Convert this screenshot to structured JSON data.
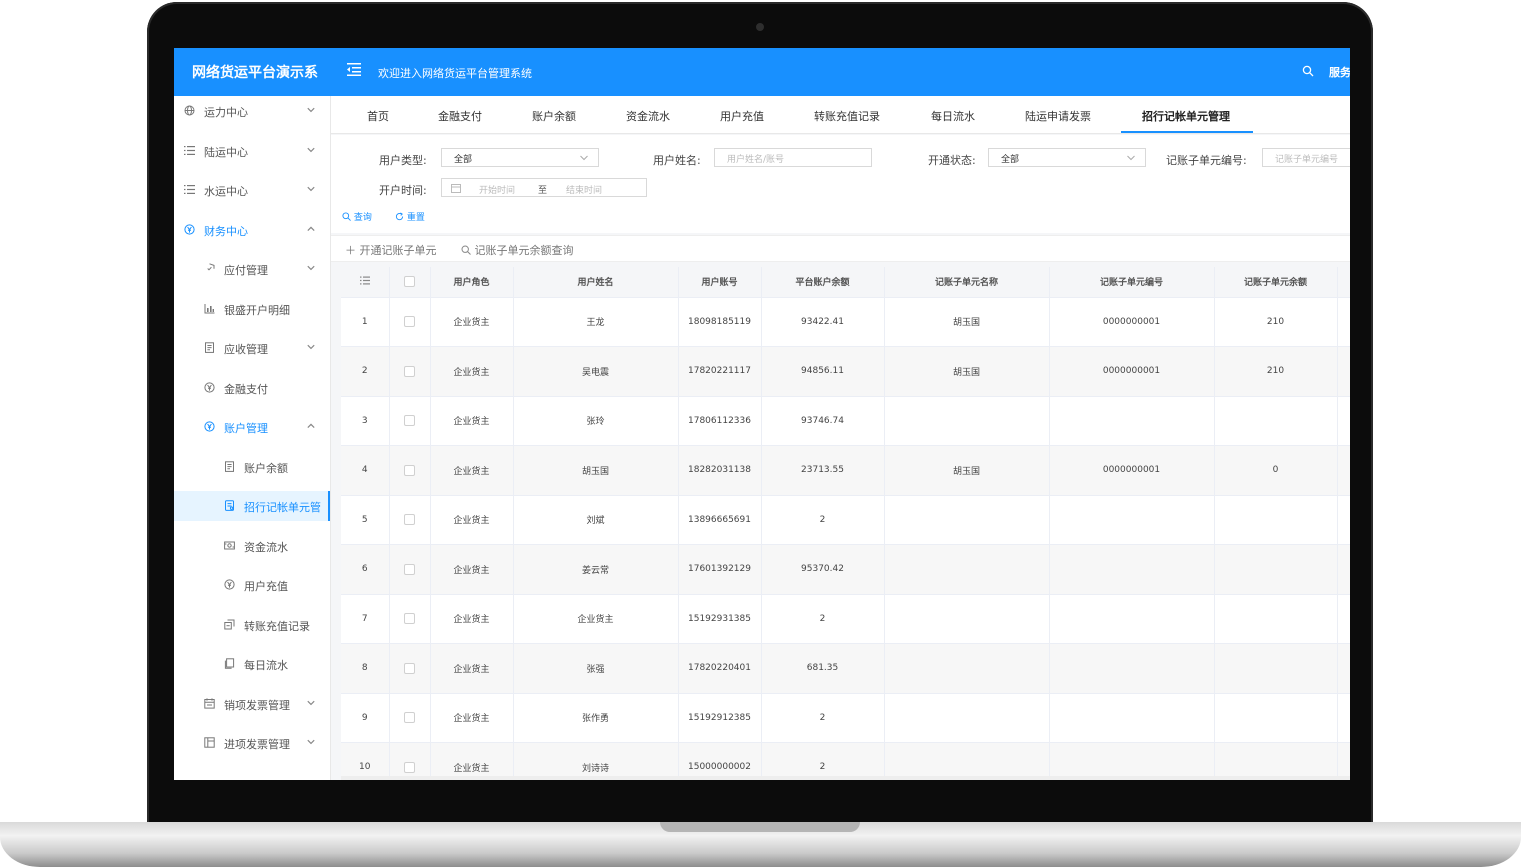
{
  "header": {
    "brand": "网络货运平台演示系",
    "welcome": "欢迎进入网络货运平台管理系统",
    "service": "服务"
  },
  "sidebar": {
    "items": [
      {
        "label": "运力中心",
        "icon": "globe-icon",
        "arrow": "down"
      },
      {
        "label": "陆运中心",
        "icon": "list-icon",
        "arrow": "down"
      },
      {
        "label": "水运中心",
        "icon": "list-icon",
        "arrow": "down"
      },
      {
        "label": "财务中心",
        "icon": "yen-icon",
        "arrow": "up"
      },
      {
        "label": "应付管理",
        "icon": "shield-icon",
        "arrow": "down"
      },
      {
        "label": "银盛开户明细",
        "icon": "bar-chart-icon",
        "arrow": ""
      },
      {
        "label": "应收管理",
        "icon": "document-icon",
        "arrow": "down"
      },
      {
        "label": "金融支付",
        "icon": "yen-icon",
        "arrow": ""
      },
      {
        "label": "账户管理",
        "icon": "yen-icon",
        "arrow": "up"
      },
      {
        "label": "账户余额",
        "icon": "document-icon",
        "arrow": ""
      },
      {
        "label": "招行记帐单元管",
        "icon": "ledger-icon",
        "arrow": ""
      },
      {
        "label": "资金流水",
        "icon": "money-icon",
        "arrow": ""
      },
      {
        "label": "用户充值",
        "icon": "yen-icon",
        "arrow": ""
      },
      {
        "label": "转账充值记录",
        "icon": "transfer-icon",
        "arrow": ""
      },
      {
        "label": "每日流水",
        "icon": "copy-icon",
        "arrow": ""
      },
      {
        "label": "销项发票管理",
        "icon": "invoice-icon",
        "arrow": "down"
      },
      {
        "label": "进项发票管理",
        "icon": "invoice-in-icon",
        "arrow": "down"
      }
    ]
  },
  "tabs": [
    "首页",
    "金融支付",
    "账户余额",
    "资金流水",
    "用户充值",
    "转账充值记录",
    "每日流水",
    "陆运申请发票",
    "招行记帐单元管理"
  ],
  "filters": {
    "user_type_label": "用户类型:",
    "user_type_value": "全部",
    "user_name_label": "用户姓名:",
    "user_name_placeholder": "用户姓名/账号",
    "status_label": "开通状态:",
    "status_value": "全部",
    "unit_no_label": "记账子单元编号:",
    "unit_no_placeholder": "记账子单元编号",
    "open_time_label": "开户时间:",
    "start_placeholder": "开始时间",
    "range_sep": "至",
    "end_placeholder": "结束时间",
    "query": "查询",
    "reset": "重置"
  },
  "toolbar": {
    "open_unit": "开通记账子单元",
    "balance_query": "记账子单元余额查询"
  },
  "table": {
    "columns": [
      "用户角色",
      "用户姓名",
      "用户账号",
      "平台账户余额",
      "记账子单元名称",
      "记账子单元编号",
      "记账子单元余额"
    ],
    "rows": [
      {
        "no": "1",
        "role": "企业货主",
        "name": "王龙",
        "account": "18098185119",
        "balance": "93422.41",
        "unit_name": "胡玉国",
        "unit_no": "0000000001",
        "unit_balance": "210"
      },
      {
        "no": "2",
        "role": "企业货主",
        "name": "吴电震",
        "account": "17820221117",
        "balance": "94856.11",
        "unit_name": "胡玉国",
        "unit_no": "0000000001",
        "unit_balance": "210"
      },
      {
        "no": "3",
        "role": "企业货主",
        "name": "张玲",
        "account": "17806112336",
        "balance": "93746.74",
        "unit_name": "",
        "unit_no": "",
        "unit_balance": ""
      },
      {
        "no": "4",
        "role": "企业货主",
        "name": "胡玉国",
        "account": "18282031138",
        "balance": "23713.55",
        "unit_name": "胡玉国",
        "unit_no": "0000000001",
        "unit_balance": "0"
      },
      {
        "no": "5",
        "role": "企业货主",
        "name": "刘斌",
        "account": "13896665691",
        "balance": "2",
        "unit_name": "",
        "unit_no": "",
        "unit_balance": ""
      },
      {
        "no": "6",
        "role": "企业货主",
        "name": "姜云常",
        "account": "17601392129",
        "balance": "95370.42",
        "unit_name": "",
        "unit_no": "",
        "unit_balance": ""
      },
      {
        "no": "7",
        "role": "企业货主",
        "name": "企业货主",
        "account": "15192931385",
        "balance": "2",
        "unit_name": "",
        "unit_no": "",
        "unit_balance": ""
      },
      {
        "no": "8",
        "role": "企业货主",
        "name": "张强",
        "account": "17820220401",
        "balance": "681.35",
        "unit_name": "",
        "unit_no": "",
        "unit_balance": ""
      },
      {
        "no": "9",
        "role": "企业货主",
        "name": "张作勇",
        "account": "15192912385",
        "balance": "2",
        "unit_name": "",
        "unit_no": "",
        "unit_balance": ""
      },
      {
        "no": "10",
        "role": "企业货主",
        "name": "刘诗诗",
        "account": "15000000002",
        "balance": "2",
        "unit_name": "",
        "unit_no": "",
        "unit_balance": ""
      }
    ]
  },
  "colors": {
    "primary": "#1890ff",
    "sidebar_selected_bg": "#e6f4ff"
  }
}
